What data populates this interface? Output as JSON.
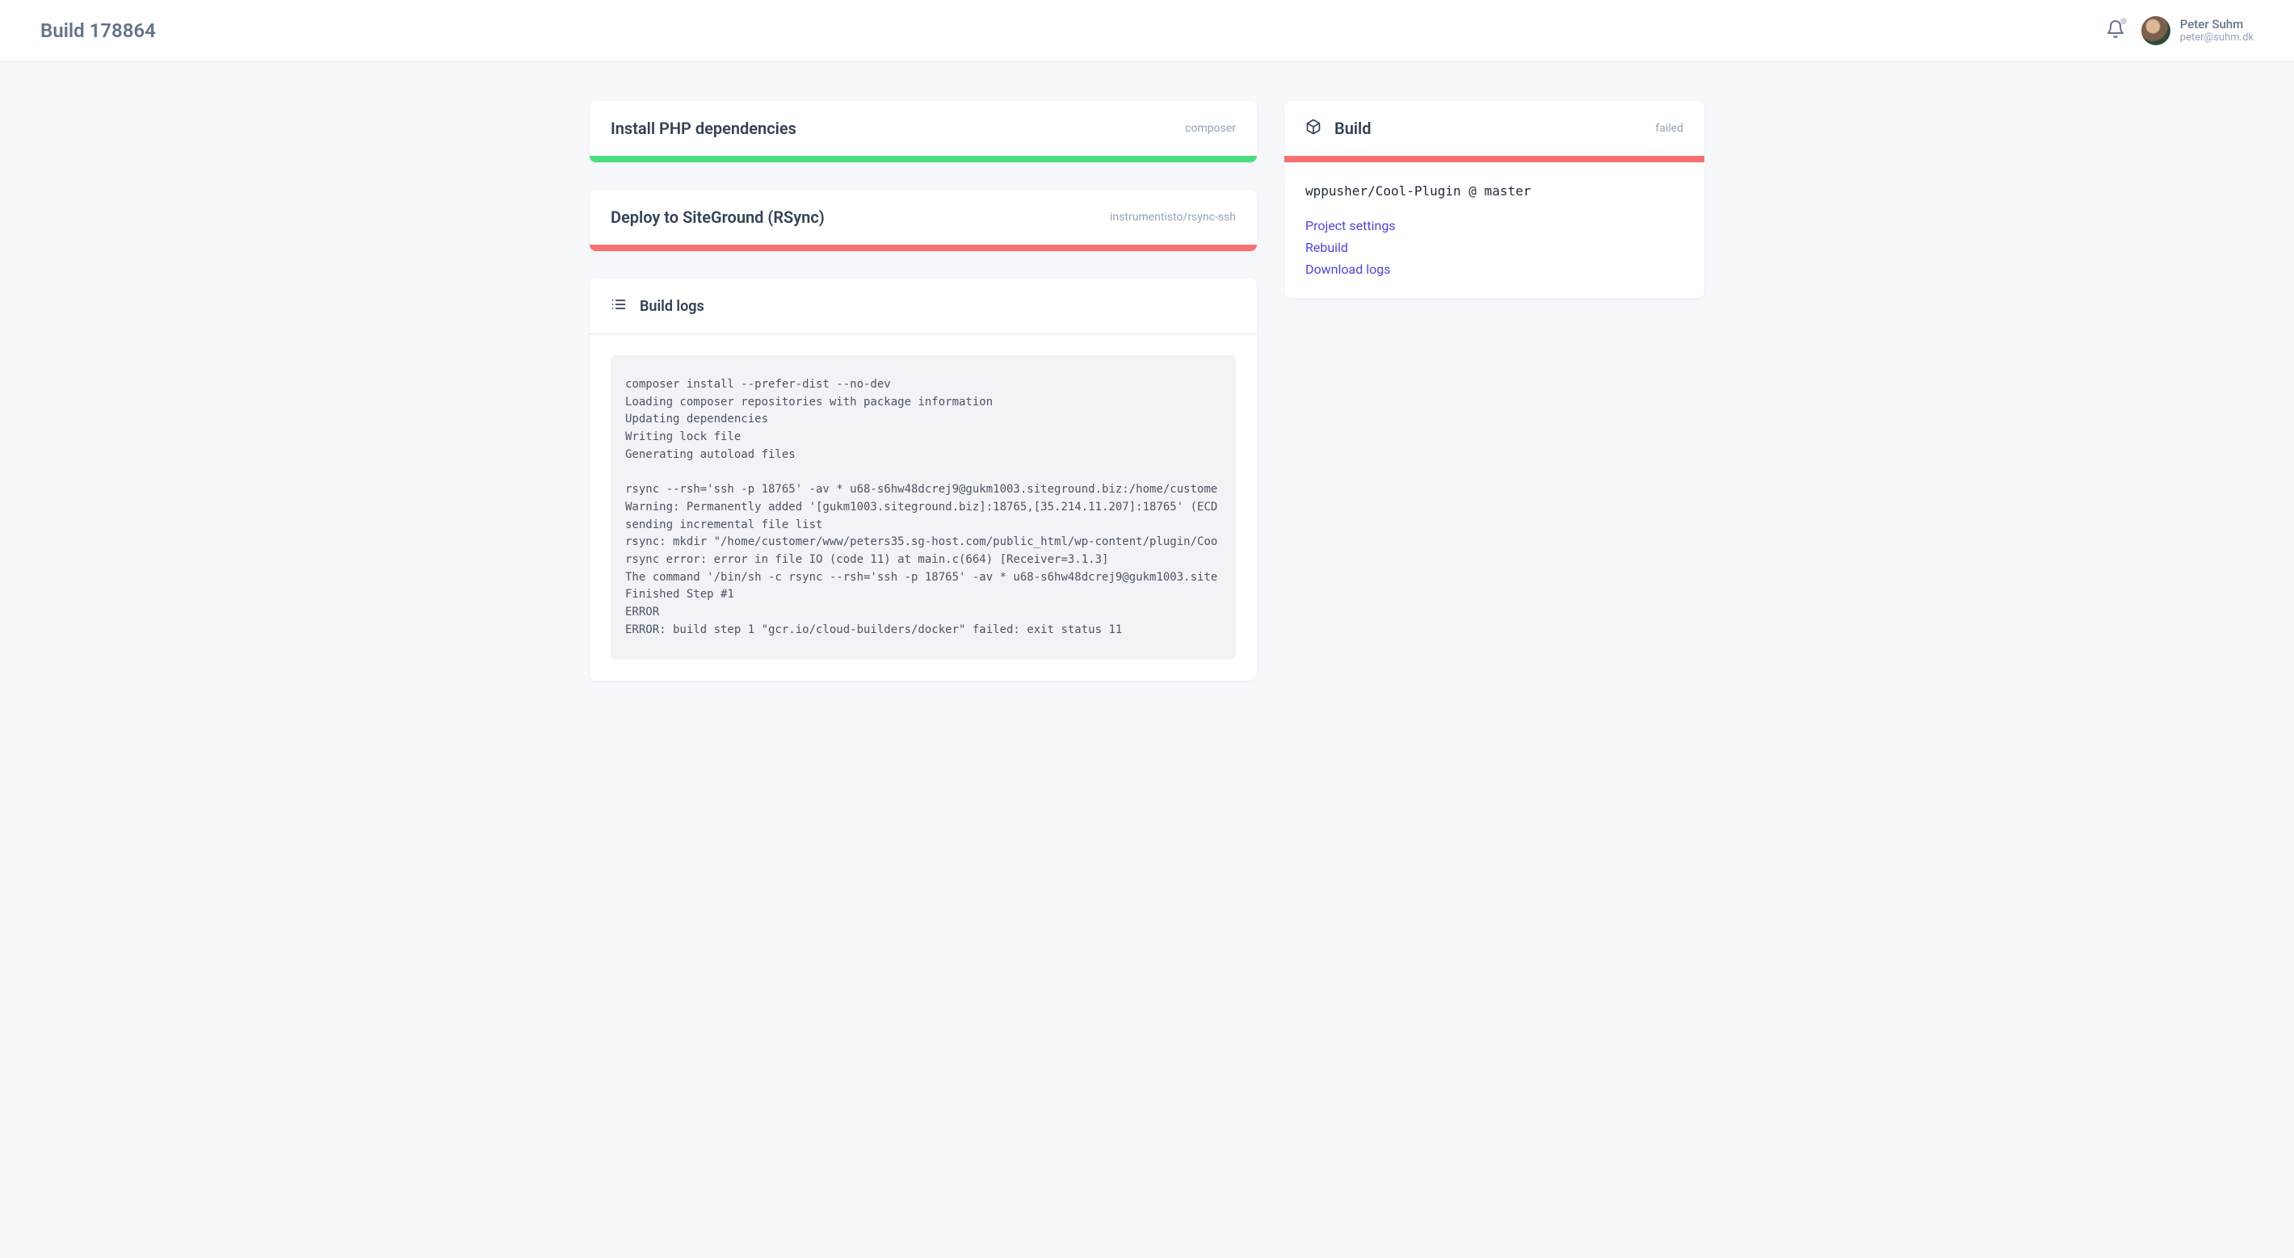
{
  "header": {
    "title": "Build 178864",
    "user_name": "Peter Suhm",
    "user_email": "peter@suhm.dk"
  },
  "steps": [
    {
      "title": "Install PHP dependencies",
      "tag": "composer",
      "status": "success"
    },
    {
      "title": "Deploy to SiteGround (RSync)",
      "tag": "instrumentisto/rsync-ssh",
      "status": "failed"
    }
  ],
  "logs": {
    "title": "Build logs",
    "content": "composer install --prefer-dist --no-dev\nLoading composer repositories with package information\nUpdating dependencies\nWriting lock file\nGenerating autoload files\n\nrsync --rsh='ssh -p 18765' -av * u68-s6hw48dcrej9@gukm1003.siteground.biz:/home/custome\nWarning: Permanently added '[gukm1003.siteground.biz]:18765,[35.214.11.207]:18765' (ECD\nsending incremental file list\nrsync: mkdir \"/home/customer/www/peters35.sg-host.com/public_html/wp-content/plugin/Coo\nrsync error: error in file IO (code 11) at main.c(664) [Receiver=3.1.3]\nThe command '/bin/sh -c rsync --rsh='ssh -p 18765' -av * u68-s6hw48dcrej9@gukm1003.site\nFinished Step #1\nERROR\nERROR: build step 1 \"gcr.io/cloud-builders/docker\" failed: exit status 11"
  },
  "sidebar": {
    "title": "Build",
    "status": "failed",
    "repo": "wppusher/Cool-Plugin @ master",
    "links": {
      "project_settings": "Project settings",
      "rebuild": "Rebuild",
      "download_logs": "Download logs"
    }
  }
}
